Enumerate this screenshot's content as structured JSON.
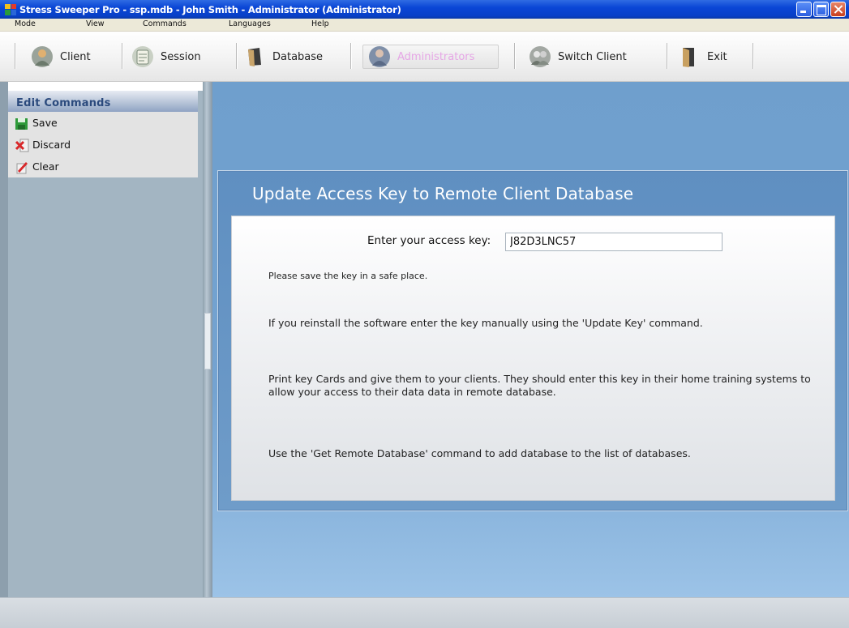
{
  "window": {
    "title": "Stress Sweeper Pro - ssp.mdb - John Smith - Administrator  (Administrator)"
  },
  "menu": {
    "items": [
      {
        "label": "Mode"
      },
      {
        "label": "View"
      },
      {
        "label": "Commands"
      },
      {
        "label": "Languages"
      },
      {
        "label": "Help"
      }
    ]
  },
  "toolbar": {
    "buttons": [
      {
        "label": "Client",
        "icon": "client-icon"
      },
      {
        "label": "Session",
        "icon": "session-icon"
      },
      {
        "label": "Database",
        "icon": "database-icon"
      },
      {
        "label": "Administrators",
        "icon": "administrators-icon",
        "active": true
      },
      {
        "label": "Switch Client",
        "icon": "switch-client-icon"
      },
      {
        "label": "Exit",
        "icon": "exit-icon"
      }
    ],
    "active_label_color": "#e6a6e6"
  },
  "edit_commands": {
    "header": "Edit Commands",
    "items": [
      {
        "label": "Save",
        "icon": "save-icon"
      },
      {
        "label": "Discard",
        "icon": "discard-icon"
      },
      {
        "label": "Clear",
        "icon": "clear-icon"
      }
    ]
  },
  "panel": {
    "title": "Update Access Key to Remote Client Database",
    "key_label": "Enter your access key:",
    "key_value": "J82D3LNC57",
    "para1": "Please save the key in a safe place.",
    "para2": "If you reinstall the software enter the key manually using the 'Update Key' command.",
    "para3": "Print key Cards and give them to your clients. They should enter this key in their home training systems to allow your access to their data data  in remote database.",
    "para4": "Use the 'Get Remote Database' command to add database to the list of databases."
  },
  "colors": {
    "titlebar": "#0a46d6",
    "main_background": "#74a3d1",
    "panel_header": "#6f9cc9"
  }
}
